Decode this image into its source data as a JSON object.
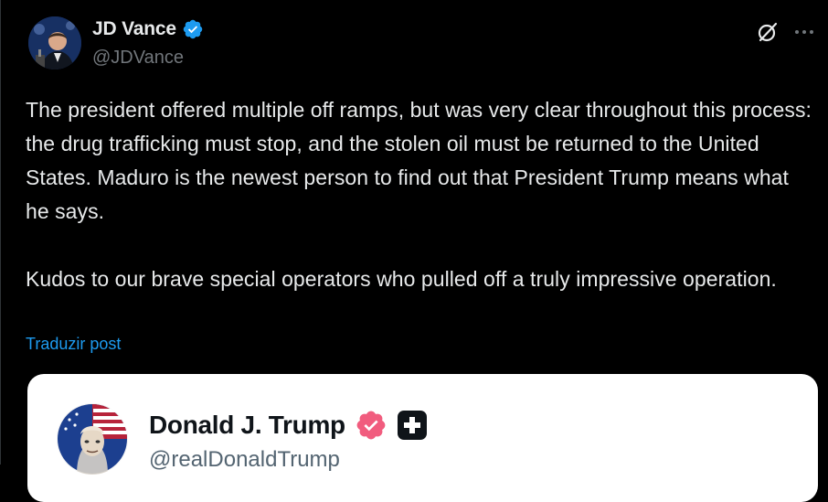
{
  "post": {
    "author": {
      "display_name": "JD Vance",
      "handle": "@JDVance",
      "verified_icon": "verified-badge-blue"
    },
    "text": "The president offered multiple off ramps, but was very clear throughout this process: the drug trafficking must stop, and the stolen oil must be returned to the United States. Maduro is the newest person to find out that President Trump means what he says.\n\nKudos to our brave special operators who pulled off a truly impressive operation.",
    "translate_label": "Traduzir post",
    "actions": {
      "grok_icon": "grok-icon",
      "more_icon": "more-icon"
    }
  },
  "quoted_post": {
    "author": {
      "display_name": "Donald J. Trump",
      "handle": "@realDonaldTrump",
      "verified_icon": "verified-badge-gold",
      "affiliate_icon": "affiliate-badge"
    }
  },
  "colors": {
    "background": "#000000",
    "text": "#e7e9ea",
    "muted": "#71767b",
    "link": "#1d9bf0",
    "quote_background": "#ffffff",
    "badge_blue": "#1d9bf0",
    "badge_gold": "#e0245e"
  }
}
